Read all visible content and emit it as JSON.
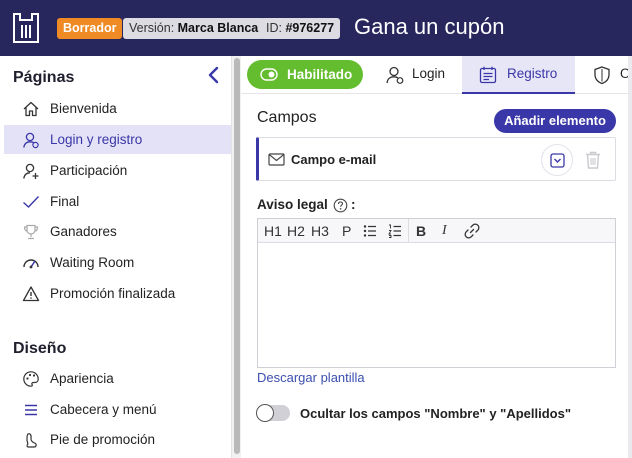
{
  "header": {
    "status_badge": "Borrador",
    "version_prefix": "Versión: ",
    "version_value": "Marca Blanca",
    "id_prefix": "ID: ",
    "id_value": "#976277",
    "title": "Gana un cupón"
  },
  "sidebar": {
    "pages_heading": "Páginas",
    "pages": [
      {
        "label": "Bienvenida",
        "icon": "home-icon",
        "active": false
      },
      {
        "label": "Login y registro",
        "icon": "user-icon",
        "active": true
      },
      {
        "label": "Participación",
        "icon": "user-plus-icon",
        "active": false
      },
      {
        "label": "Final",
        "icon": "check-icon",
        "active": false
      },
      {
        "label": "Ganadores",
        "icon": "trophy-icon",
        "active": false
      },
      {
        "label": "Waiting Room",
        "icon": "gauge-icon",
        "active": false
      },
      {
        "label": "Promoción finalizada",
        "icon": "warning-icon",
        "active": false
      }
    ],
    "design_heading": "Diseño",
    "design": [
      {
        "label": "Apariencia",
        "icon": "palette-icon"
      },
      {
        "label": "Cabecera y menú",
        "icon": "menu-icon"
      },
      {
        "label": "Pie de promoción",
        "icon": "footprint-icon"
      }
    ]
  },
  "tabs": {
    "enabled_label": "Habilitado",
    "login": "Login",
    "registro": "Registro",
    "other": "O"
  },
  "fields": {
    "section_title": "Campos",
    "add_button": "Añadir elemento",
    "items": [
      {
        "label": "Campo e-mail",
        "icon": "mail-icon"
      }
    ]
  },
  "legal": {
    "label": "Aviso legal",
    "colon": ":",
    "toolbar": {
      "h1": "H1",
      "h2": "H2",
      "h3": "H3",
      "p": "P",
      "bold": "B",
      "italic": "I"
    },
    "content": ""
  },
  "download_link": "Descargar plantilla",
  "hide_names": {
    "label": "Ocultar los campos \"Nombre\" y \"Apellidos\"",
    "enabled": false
  },
  "colors": {
    "topbar": "#27275e",
    "accent": "#3a37a8",
    "enabled": "#64bd2e",
    "draft": "#f08a24"
  }
}
